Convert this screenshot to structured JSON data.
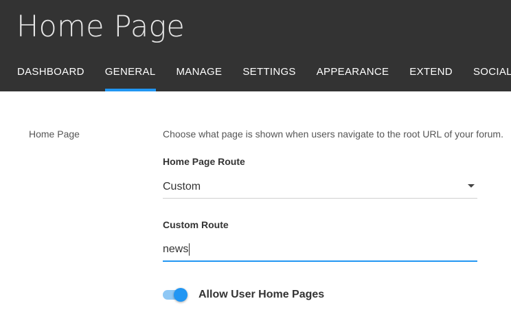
{
  "header": {
    "title": "Home Page",
    "tabs": [
      {
        "label": "DASHBOARD"
      },
      {
        "label": "GENERAL"
      },
      {
        "label": "MANAGE"
      },
      {
        "label": "SETTINGS"
      },
      {
        "label": "APPEARANCE"
      },
      {
        "label": "EXTEND"
      },
      {
        "label": "SOCIAL A"
      }
    ],
    "active_tab": "GENERAL"
  },
  "section": {
    "label": "Home Page",
    "description": "Choose what page is shown when users navigate to the root URL of your forum."
  },
  "route_field": {
    "label": "Home Page Route",
    "selected_value": "Custom"
  },
  "custom_route_field": {
    "label": "Custom Route",
    "value": "news"
  },
  "user_home_toggle": {
    "label": "Allow User Home Pages",
    "enabled": true
  },
  "colors": {
    "header_bg": "#333333",
    "accent": "#2196f3",
    "toggle_track": "#8fc8f5"
  }
}
